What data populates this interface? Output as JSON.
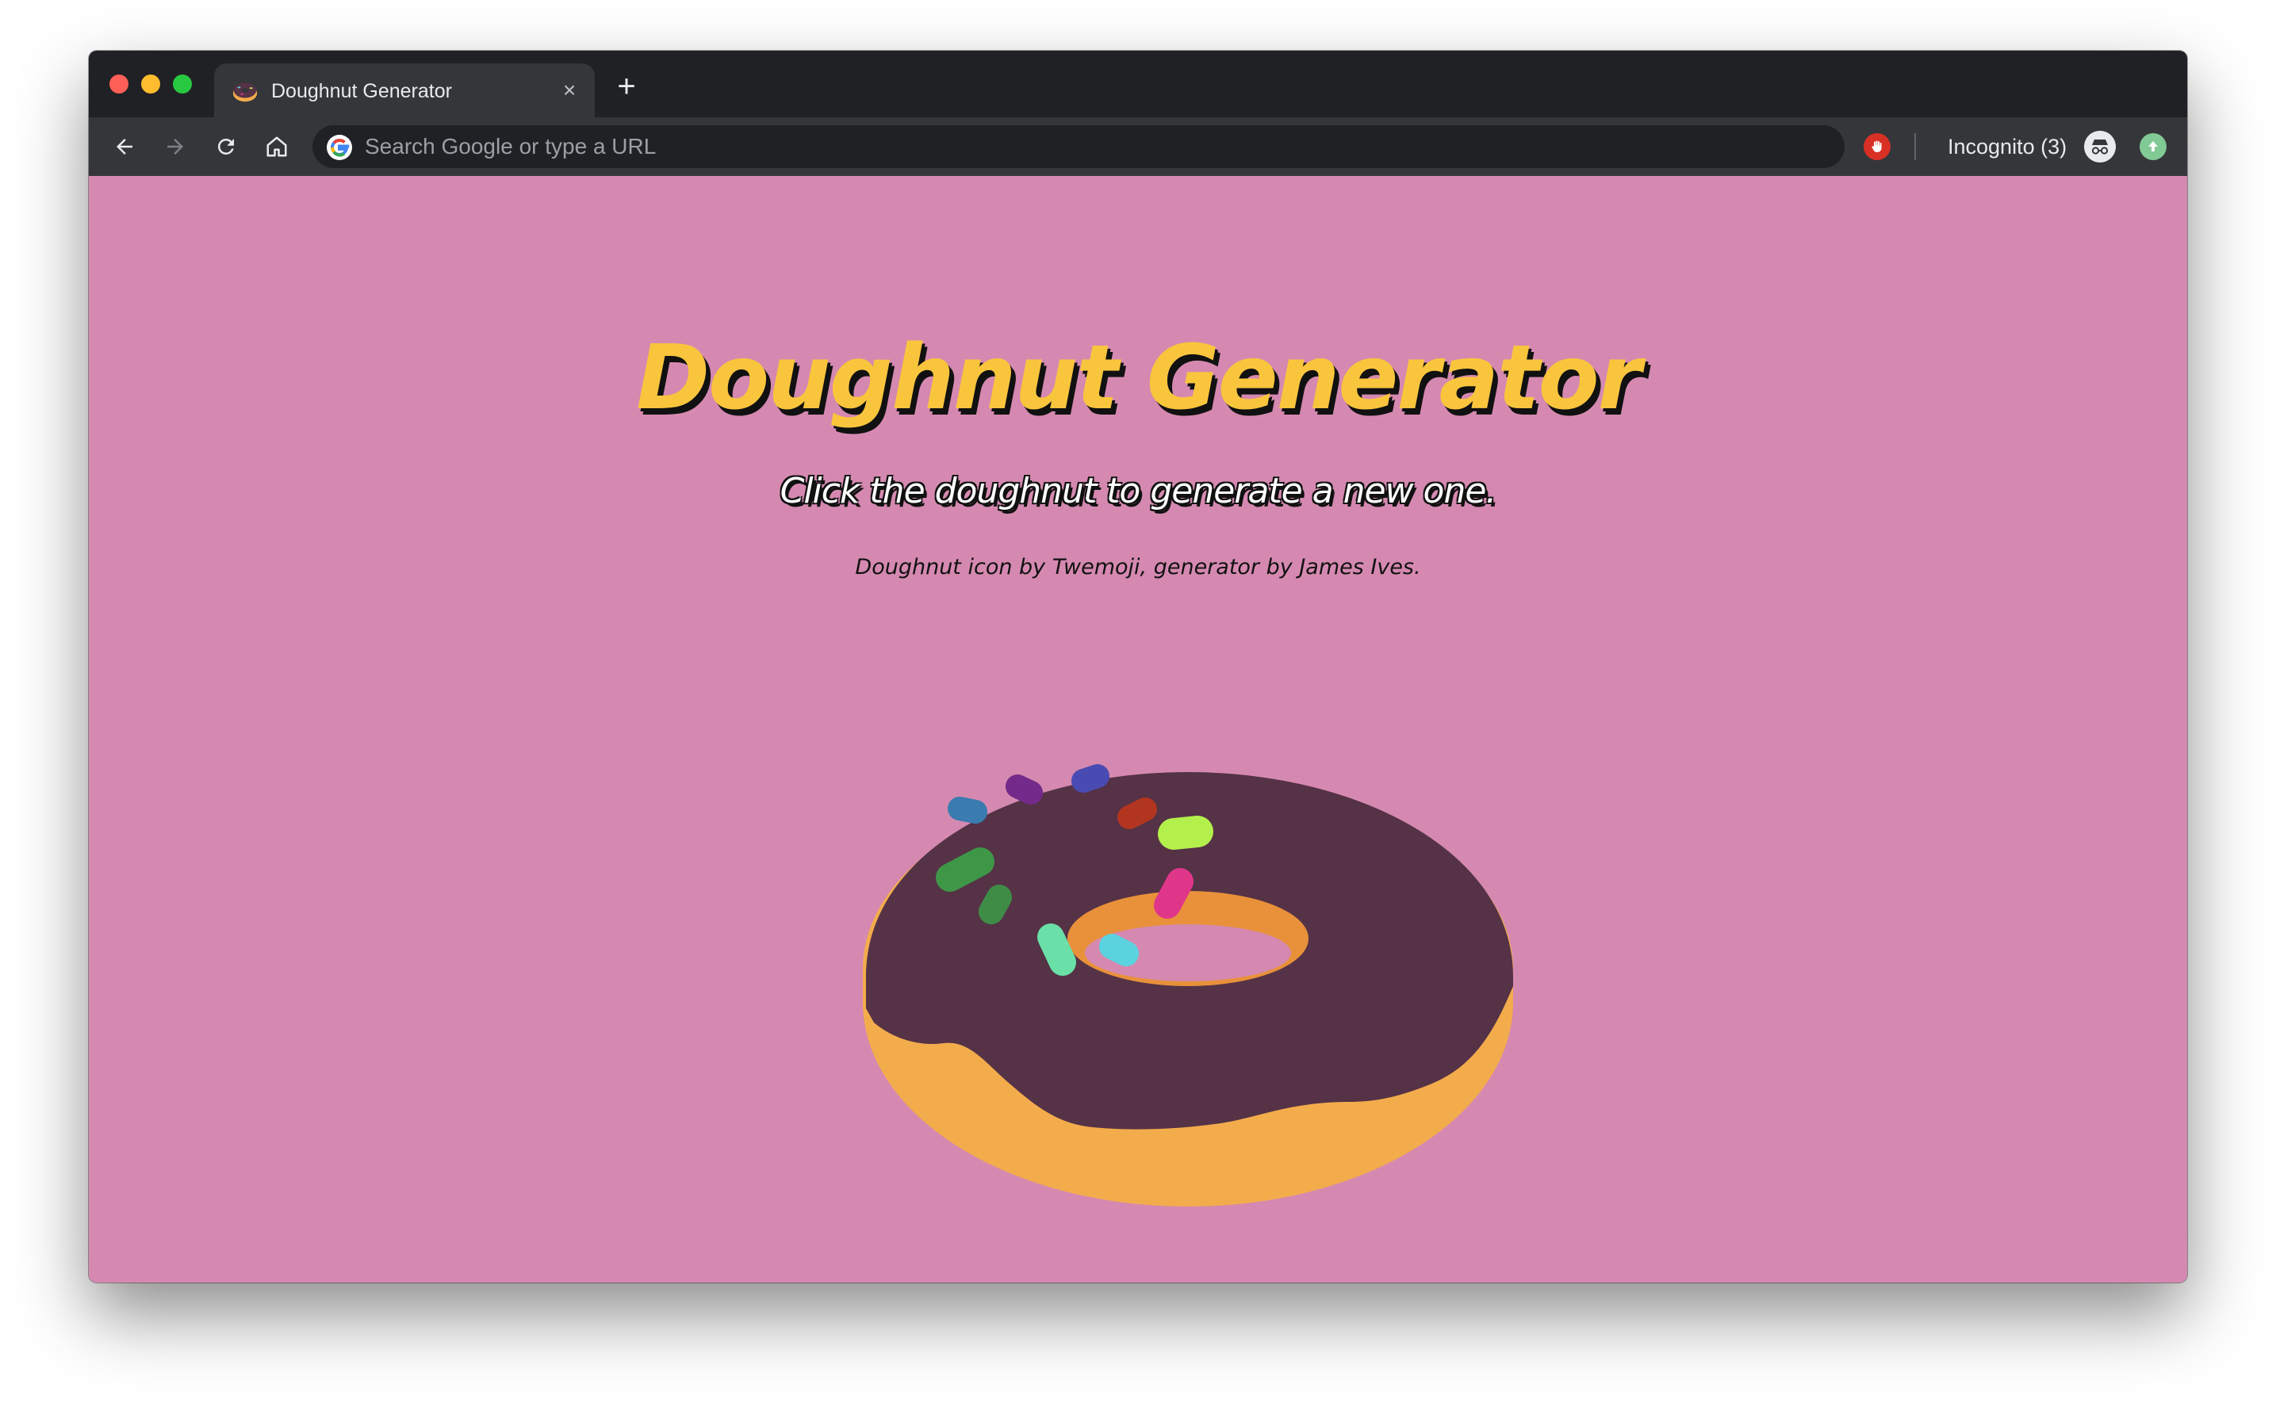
{
  "browser": {
    "tab": {
      "title": "Doughnut Generator",
      "favicon": "doughnut-emoji"
    },
    "new_tab_label": "+",
    "close_label": "×",
    "omnibox": {
      "placeholder": "Search Google or type a URL"
    },
    "incognito_label": "Incognito (3)"
  },
  "page": {
    "title": "Doughnut Generator",
    "subtitle": "Click the doughnut to generate a new one.",
    "credits": "Doughnut icon by Twemoji, generator by James Ives."
  },
  "doughnut": {
    "dough_color": "#f3ac4c",
    "icing_color": "#553246",
    "hole_ring_color": "#e8913a",
    "sprinkle_colors": [
      "#3a7bb0",
      "#732a8a",
      "#4a4bb2",
      "#b23520",
      "#b3f04c",
      "#3e9647",
      "#e0368a",
      "#3f8c46",
      "#6ae0a8",
      "#5ad3df"
    ]
  },
  "colors": {
    "page_background": "#d589b0",
    "title_color": "#f9c53d",
    "chrome_dark": "#202124",
    "chrome_toolbar": "#35363a"
  }
}
